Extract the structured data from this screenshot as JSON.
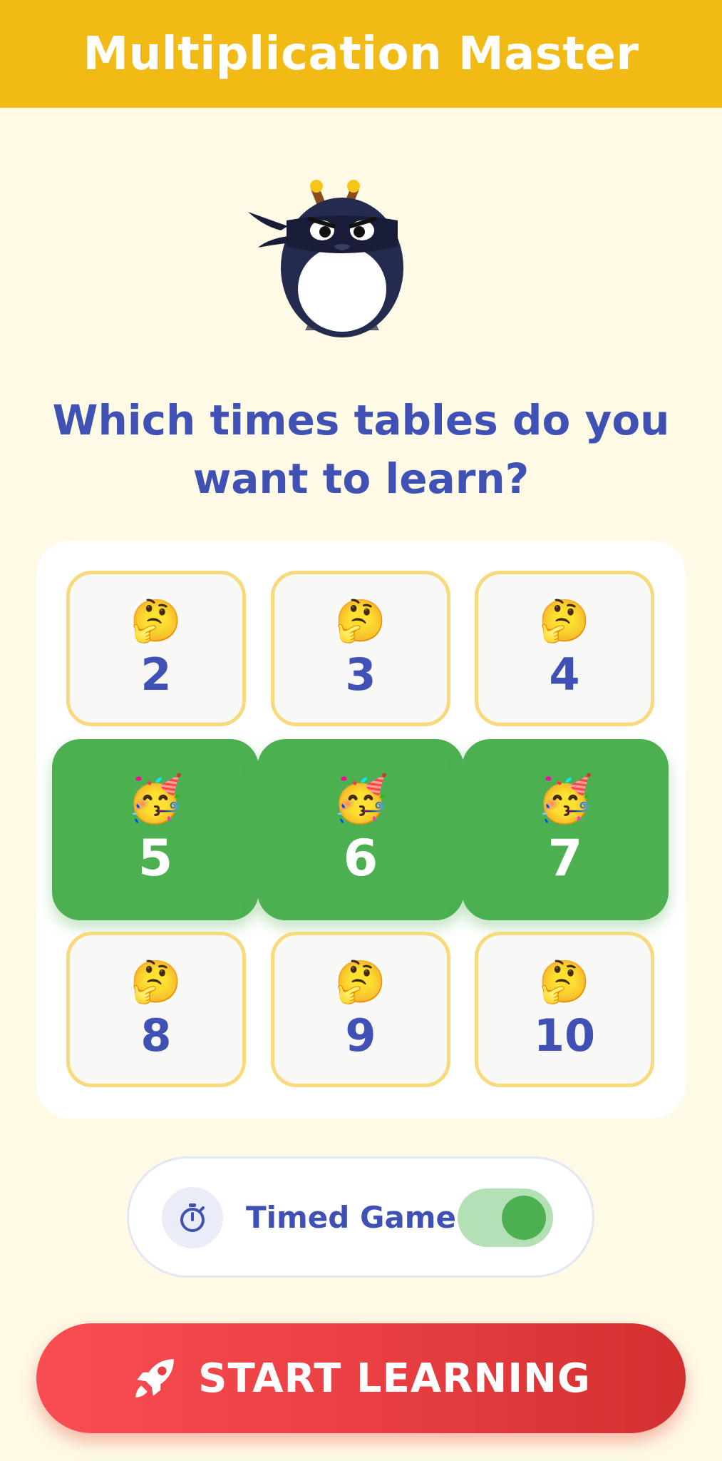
{
  "header": {
    "title": "Multiplication Master"
  },
  "question": {
    "line1": "Which times tables do you",
    "line2": "want to learn?"
  },
  "tables": [
    {
      "label": "2",
      "emoji": "🤔",
      "selected": false
    },
    {
      "label": "3",
      "emoji": "🤔",
      "selected": false
    },
    {
      "label": "4",
      "emoji": "🤔",
      "selected": false
    },
    {
      "label": "5",
      "emoji": "🥳",
      "selected": true
    },
    {
      "label": "6",
      "emoji": "🥳",
      "selected": true
    },
    {
      "label": "7",
      "emoji": "🥳",
      "selected": true
    },
    {
      "label": "8",
      "emoji": "🤔",
      "selected": false
    },
    {
      "label": "9",
      "emoji": "🤔",
      "selected": false
    },
    {
      "label": "10",
      "emoji": "🤔",
      "selected": false
    }
  ],
  "timed_game": {
    "label": "Timed Game",
    "enabled": true,
    "icon": "stopwatch-icon"
  },
  "start_button": {
    "label": "START LEARNING",
    "icon": "rocket-icon"
  },
  "colors": {
    "header": "#F2BA14",
    "background": "#FEFAE6",
    "accent_text": "#3F51B5",
    "selected_tile": "#4CAF50",
    "tile_border": "#F8DA7C",
    "start_button": "#E83E42"
  }
}
